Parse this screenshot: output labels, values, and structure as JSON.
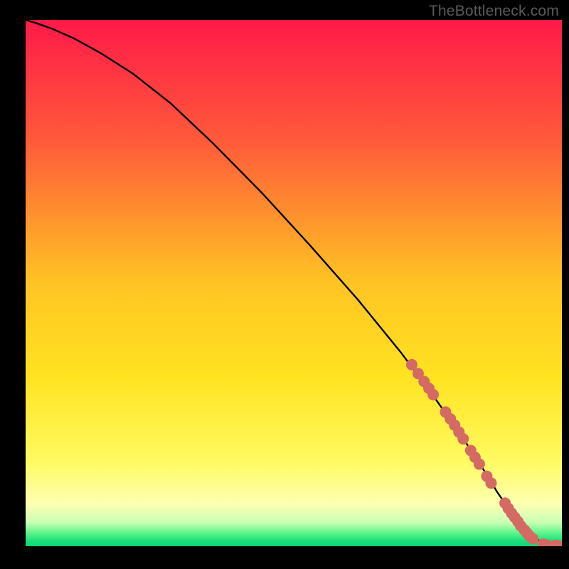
{
  "watermark": "TheBottleneck.com",
  "chart_data": {
    "type": "line",
    "title": "",
    "xlabel": "",
    "ylabel": "",
    "xlim": [
      0,
      100
    ],
    "ylim": [
      0,
      100
    ],
    "grid": false,
    "legend": false,
    "gradient_stops": [
      {
        "offset": 0.0,
        "color": "#ff1a48"
      },
      {
        "offset": 0.23,
        "color": "#ff5a3a"
      },
      {
        "offset": 0.5,
        "color": "#ffc423"
      },
      {
        "offset": 0.68,
        "color": "#ffe321"
      },
      {
        "offset": 0.84,
        "color": "#fffb62"
      },
      {
        "offset": 0.92,
        "color": "#fdffb2"
      },
      {
        "offset": 0.955,
        "color": "#c8ffb5"
      },
      {
        "offset": 0.975,
        "color": "#5cf48a"
      },
      {
        "offset": 0.99,
        "color": "#19e07a"
      },
      {
        "offset": 1.0,
        "color": "#0dd878"
      }
    ],
    "series": [
      {
        "name": "curve",
        "color": "#000000",
        "x": [
          0,
          2,
          5,
          9,
          14,
          20,
          27,
          35,
          44,
          53,
          62,
          70,
          76,
          81,
          85,
          88,
          90.5,
          92,
          94,
          96,
          98,
          100
        ],
        "y": [
          100,
          99.4,
          98.3,
          96.5,
          93.7,
          89.8,
          84.2,
          76.5,
          67.2,
          57.2,
          46.8,
          36.8,
          28.6,
          21.4,
          15.2,
          10.2,
          6.5,
          4.2,
          2.2,
          0.9,
          0.25,
          0.12
        ]
      }
    ],
    "markers": {
      "name": "highlighted-points",
      "color": "#d46a63",
      "radius": 8,
      "points": [
        {
          "x": 72.0,
          "y": 34.5
        },
        {
          "x": 73.2,
          "y": 32.8
        },
        {
          "x": 74.3,
          "y": 31.3
        },
        {
          "x": 75.2,
          "y": 30.0
        },
        {
          "x": 76.0,
          "y": 28.8
        },
        {
          "x": 78.3,
          "y": 25.5
        },
        {
          "x": 79.2,
          "y": 24.2
        },
        {
          "x": 80.0,
          "y": 23.0
        },
        {
          "x": 80.8,
          "y": 21.7
        },
        {
          "x": 81.6,
          "y": 20.4
        },
        {
          "x": 83.0,
          "y": 18.2
        },
        {
          "x": 83.8,
          "y": 16.9
        },
        {
          "x": 84.6,
          "y": 15.6
        },
        {
          "x": 86.0,
          "y": 13.3
        },
        {
          "x": 86.8,
          "y": 12.0
        },
        {
          "x": 89.4,
          "y": 8.2
        },
        {
          "x": 90.0,
          "y": 7.2
        },
        {
          "x": 90.6,
          "y": 6.3
        },
        {
          "x": 91.2,
          "y": 5.5
        },
        {
          "x": 91.8,
          "y": 4.7
        },
        {
          "x": 92.3,
          "y": 3.9
        },
        {
          "x": 93.0,
          "y": 3.1
        },
        {
          "x": 93.5,
          "y": 2.5
        },
        {
          "x": 94.0,
          "y": 1.9
        },
        {
          "x": 94.6,
          "y": 1.4
        },
        {
          "x": 96.5,
          "y": 0.4
        },
        {
          "x": 97.1,
          "y": 0.25
        },
        {
          "x": 98.7,
          "y": 0.15
        },
        {
          "x": 99.2,
          "y": 0.13
        }
      ]
    }
  }
}
